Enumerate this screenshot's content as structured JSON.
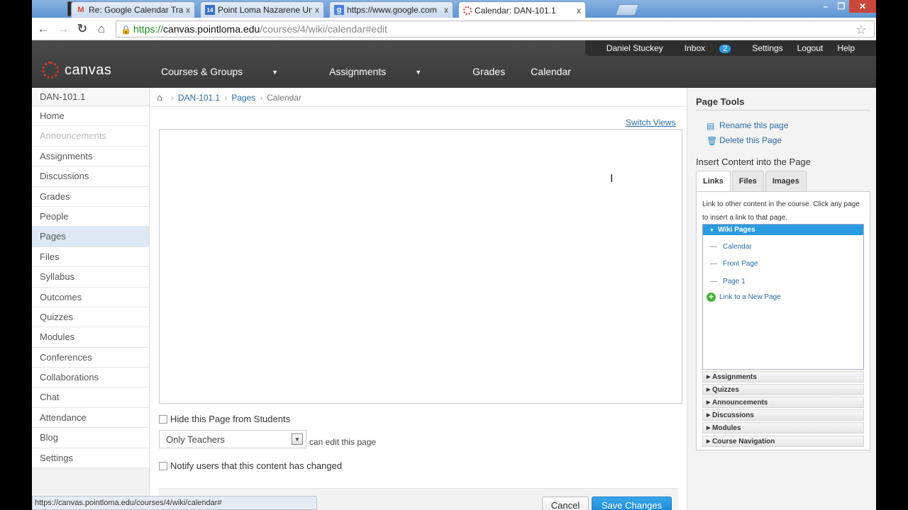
{
  "browser": {
    "tabs": [
      {
        "label": "Re: Google Calendar Train",
        "icon": "gmail-icon"
      },
      {
        "label": "Point Loma Nazarene Uni",
        "icon": "calendar-favicon"
      },
      {
        "label": "https://www.google.com",
        "icon": "google-icon"
      },
      {
        "label": "Calendar: DAN-101.1",
        "icon": "canvas-favicon"
      }
    ],
    "close_glyph": "x",
    "url_https": "https://",
    "url_host": "canvas.pointloma.edu",
    "url_path": "/courses/4/wiki/calendar#edit",
    "status_url": "https://canvas.pointloma.edu/courses/4/wiki/calendar#"
  },
  "header": {
    "logo_text": "canvas",
    "user_nav": {
      "name": "Daniel Stuckey",
      "inbox": "Inbox",
      "inbox_count": "2",
      "settings": "Settings",
      "logout": "Logout",
      "help": "Help"
    },
    "main_nav": [
      "Courses & Groups",
      "Assignments",
      "Grades",
      "Calendar"
    ]
  },
  "course_nav": {
    "title": "DAN-101.1",
    "items": [
      "Home",
      "Announcements",
      "Assignments",
      "Discussions",
      "Grades",
      "People",
      "Pages",
      "Files",
      "Syllabus",
      "Outcomes",
      "Quizzes",
      "Modules",
      "Conferences",
      "Collaborations",
      "Chat",
      "Attendance",
      "Blog",
      "Settings"
    ],
    "selected": "Pages",
    "disabled": "Announcements"
  },
  "breadcrumb": [
    "DAN-101.1",
    "Pages",
    "Calendar"
  ],
  "editor": {
    "switch_views": "Switch Views",
    "hide_label": "Hide this Page from Students",
    "edit_select_value": "Only Teachers",
    "edit_suffix": "can edit this page",
    "notify_label": "Notify users that this content has changed",
    "cancel_label": "Cancel",
    "save_label": "Save Changes"
  },
  "page_tools": {
    "title": "Page Tools",
    "rename": "Rename this page",
    "delete": "Delete this Page",
    "insert_title": "Insert Content into the Page",
    "tabs": [
      "Links",
      "Files",
      "Images"
    ],
    "help_text": "Link to other content in the course. Click any page to insert a link to that page.",
    "wiki_header": "Wiki Pages",
    "wiki_pages": [
      "Calendar",
      "Front Page",
      "Page 1"
    ],
    "new_page_link": "Link to a New Page",
    "sections": [
      "Assignments",
      "Quizzes",
      "Announcements",
      "Discussions",
      "Modules",
      "Course Navigation"
    ]
  },
  "colors": {
    "accent": "#2a9be0",
    "brand": "#d1362b",
    "header_bg": "#3f3f3f"
  }
}
